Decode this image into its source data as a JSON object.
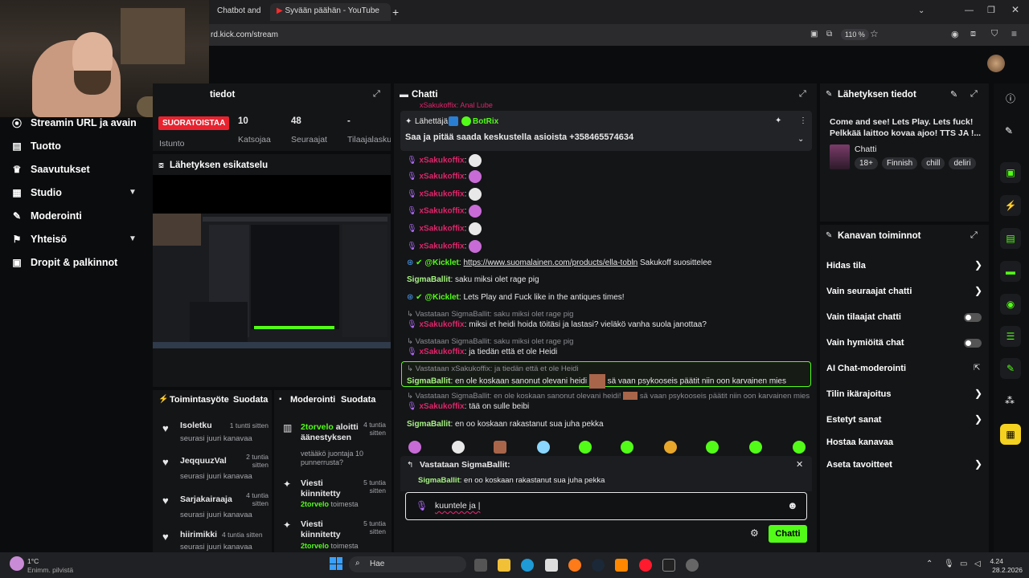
{
  "browser": {
    "tabs": [
      {
        "label": "Chatbot and"
      },
      {
        "label": "Syvään päähän - YouTube"
      }
    ],
    "new_tab_icon": "+",
    "url": "rd.kick.com/stream",
    "zoom": "110 %"
  },
  "sidebar": {
    "items": [
      {
        "label": "Streamin URL ja avain",
        "icon": "broadcast-icon"
      },
      {
        "label": "Tuotto",
        "icon": "revenue-icon"
      },
      {
        "label": "Saavutukset",
        "icon": "trophy-icon"
      },
      {
        "label": "Studio",
        "icon": "studio-icon",
        "expandable": true
      },
      {
        "label": "Moderointi",
        "icon": "wrench-icon"
      },
      {
        "label": "Yhteisö",
        "icon": "community-icon",
        "expandable": true
      },
      {
        "label": "Dropit & palkinnot",
        "icon": "gift-icon"
      }
    ]
  },
  "stream_info": {
    "title": "tiedot",
    "live_badge": "SUORATOISTAA",
    "live_color": "#e8232f",
    "session_label": "Istunto",
    "stats": [
      {
        "value": "10",
        "label": "Katsojaa"
      },
      {
        "value": "48",
        "label": "Seuraajat"
      },
      {
        "value": "-",
        "label": "Tilaajalasku"
      }
    ]
  },
  "preview": {
    "title": "Lähetyksen esikatselu"
  },
  "activity": {
    "title": "Toimintasyöte",
    "filter": "Suodata",
    "items": [
      {
        "user": "Isoletku",
        "time": "1 tuntti sitten",
        "text": "seurasi juuri kanavaa"
      },
      {
        "user": "JeqquuzVal",
        "time": "2 tuntia sitten",
        "text": "seurasi juuri kanavaa"
      },
      {
        "user": "Sarjakairaaja",
        "time": "4 tuntia sitten",
        "text": "seurasi juuri kanavaa"
      },
      {
        "user": "hiirimikki",
        "time": "4 tuntia sitten",
        "text": "seurasi juuri kanavaa"
      }
    ]
  },
  "moderation": {
    "title": "Moderointi",
    "filter": "Suodata",
    "items": [
      {
        "user": "2torvelo",
        "title": "aloitti äänestyksen",
        "time": "4 tuntia sitten",
        "detail": "vetääkö juontaja 10 punnerrusta?"
      },
      {
        "user": "2torvelo",
        "title": "Viesti kiinnitetty",
        "time": "5 tuntia sitten",
        "detail": "toimesta"
      },
      {
        "user": "2torvelo",
        "title": "Viesti kiinnitetty",
        "time": "5 tuntia sitten",
        "detail": "toimesta"
      }
    ]
  },
  "chat": {
    "title": "Chatti",
    "top_partial": "xSakukoffix: Anal Lube",
    "pinned": {
      "sender_label": "Lähettäjä",
      "sender": "BotRix",
      "text": "Saa ja pitää saada keskustella asioista +358465574634"
    },
    "messages": [
      {
        "user": "xSakukoffix",
        "text": ":",
        "type": "emote"
      },
      {
        "user": "xSakukoffix",
        "text": ":",
        "type": "emote"
      },
      {
        "user": "xSakukoffix",
        "text": ":",
        "type": "emote"
      },
      {
        "user": "xSakukoffix",
        "text": ":",
        "type": "emote"
      },
      {
        "user": "xSakukoffix",
        "text": ":",
        "type": "emote"
      },
      {
        "user": "xSakukoffix",
        "text": ":",
        "type": "emote"
      }
    ],
    "kicklet1": {
      "user": "@Kicklet",
      "link": "https://www.suomalainen.com/products/ella-tobln",
      "text": "Sakukoff suosittelee"
    },
    "sigma1": {
      "user": "SigmaBallit",
      "text": "saku miksi olet rage pig"
    },
    "kicklet2": {
      "user": "@Kicklet",
      "text": "Lets Play and Fuck like in the antiques times!"
    },
    "reply1": {
      "reply": "Vastataan SigmaBallit: saku miksi olet rage pig",
      "user": "xSakukoffix",
      "text": "miksi et heidi hoida töitäsi ja lastasi? vieläkö vanha suola janottaa?"
    },
    "reply2": {
      "reply": "Vastataan SigmaBallit: saku miksi olet rage pig",
      "user": "xSakukoffix",
      "text": "ja tiedän että et ole Heidi"
    },
    "reply3": {
      "reply": "Vastataan xSakukoffix: ja tiedän että et ole Heidi",
      "user": "SigmaBallit",
      "text": "en ole koskaan sanonut olevani heidi",
      "text2": "sä vaan psykooseis päätit niin oon karvainen mies"
    },
    "reply4": {
      "reply": "Vastataan SigmaBallit: en ole koskaan sanonut olevani heidi!",
      "reply2": "sä vaan psykooseis päätit niin oon karvainen mies",
      "user": "xSakukoffix",
      "text": "tää on sulle beibi"
    },
    "sigma2": {
      "user": "SigmaBallit",
      "text": "en oo koskaan rakastanut sua juha pekka"
    },
    "replying": {
      "label": "Vastataan SigmaBallit:",
      "user": "SigmaBallit",
      "text": "en oo koskaan rakastanut sua juha pekka"
    },
    "input_value": "kuuntele ja |",
    "send_label": "Chatti"
  },
  "broadcast": {
    "title": "Lähetyksen tiedot",
    "stream_title": "Come and see! Lets Play. Lets fuck! Pelkkää laittoo kovaa ajoo! TTS JA !...",
    "category": "Chatti",
    "tags": [
      "18+",
      "Finnish",
      "chill",
      "deliri"
    ]
  },
  "channel_actions": {
    "title": "Kanavan toiminnot",
    "items": [
      {
        "label": "Hidas tila",
        "control": "arrow"
      },
      {
        "label": "Vain seuraajat chatti",
        "control": "arrow"
      },
      {
        "label": "Vain tilaajat chatti",
        "control": "toggle"
      },
      {
        "label": "Vain hymiöitä chat",
        "control": "toggle"
      },
      {
        "label": "AI Chat-moderointi",
        "control": "external"
      },
      {
        "label": "Tilin ikärajoitus",
        "control": "arrow"
      },
      {
        "label": "Estetyt sanat",
        "control": "arrow"
      },
      {
        "label": "Hostaa kanavaa",
        "control": "none"
      },
      {
        "label": "Aseta tavoitteet",
        "control": "arrow"
      }
    ]
  },
  "taskbar": {
    "weather": "1°C",
    "weather_desc": "Enimm. pilvistä",
    "search": "Hae",
    "time": "4.24",
    "date": "28.2.2026"
  },
  "colors": {
    "accent": "#53fc18",
    "live": "#e8232f",
    "username_pink": "#e0246a",
    "username_green": "#a6f283"
  }
}
